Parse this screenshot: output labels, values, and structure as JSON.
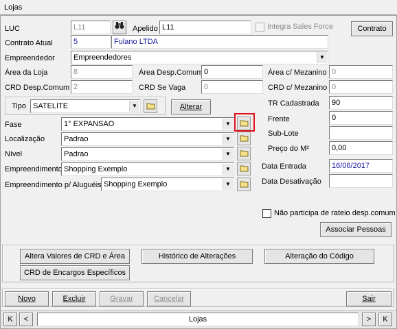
{
  "window": {
    "title": "Lojas"
  },
  "form": {
    "luc_label": "LUC",
    "luc_value": "L11",
    "apelido_label": "Apelido",
    "apelido_value": "L11",
    "integra_label": "Integra Sales Force",
    "contrato_button": "Contrato",
    "contrato_atual_label": "Contrato Atual",
    "contrato_num": "5",
    "contrato_nome": "Fulano LTDA",
    "empreendedor_label": "Empreendedor",
    "empreendedor_value": "Empreendedores",
    "area_loja_label": "Área da Loja",
    "area_loja_value": "8",
    "area_desp_label": "Área Desp.Comum",
    "area_desp_value": "0",
    "area_mezanino_label": "Área c/ Mezanino",
    "area_mezanino_value": "0",
    "crd_desp_label": "CRD Desp.Comum",
    "crd_desp_value": "2",
    "crd_vaga_label": "CRD Se Vaga",
    "crd_vaga_value": "0",
    "crd_mezanino_label": "CRD c/ Mezanino",
    "crd_mezanino_value": "0",
    "tipo_label": "Tipo",
    "tipo_value": "SATELITE",
    "alterar_button": "Alterar",
    "tr_label": "TR Cadastrada",
    "tr_value": "90",
    "fase_label": "Fase",
    "fase_value": "1° EXPANSAO",
    "frente_label": "Frente",
    "frente_value": "0",
    "localizacao_label": "Localização",
    "localizacao_value": "Padrao",
    "sublote_label": "Sub-Lote",
    "sublote_value": "",
    "nivel_label": "Nível",
    "nivel_value": "Padrao",
    "preco_label": "Preço do M²",
    "preco_value": "0,00",
    "empreendimento_label": "Empreendimento",
    "empreendimento_value": "Shopping Exemplo",
    "data_entrada_label": "Data Entrada",
    "data_entrada_value": "16/06/2017",
    "emp_alugueis_label": "Empreendimento p/ Aluguéis",
    "emp_alugueis_value": "Shopping Exemplo",
    "data_desativacao_label": "Data Desativação",
    "data_desativacao_value": "",
    "rateio_label": "Não participa de rateio desp.comum",
    "associar_button": "Associar Pessoas"
  },
  "actions": {
    "altera_valores": "Altera Valores de CRD e Área",
    "historico": "Histórico de Alterações",
    "alteracao_codigo": "Alteração do Código",
    "crd_encargos": "CRD de Encargos Específicos"
  },
  "toolbar": {
    "novo": "Novo",
    "excluir": "Excluir",
    "gravar": "Gravar",
    "cancelar": "Cancelar",
    "sair": "Sair"
  },
  "navigator": {
    "first": "K",
    "prev": "<",
    "caption": "Lojas",
    "next": ">",
    "last": "K"
  },
  "colors": {
    "highlight": "#e0101a",
    "blue_text": "#1a1aa0"
  }
}
